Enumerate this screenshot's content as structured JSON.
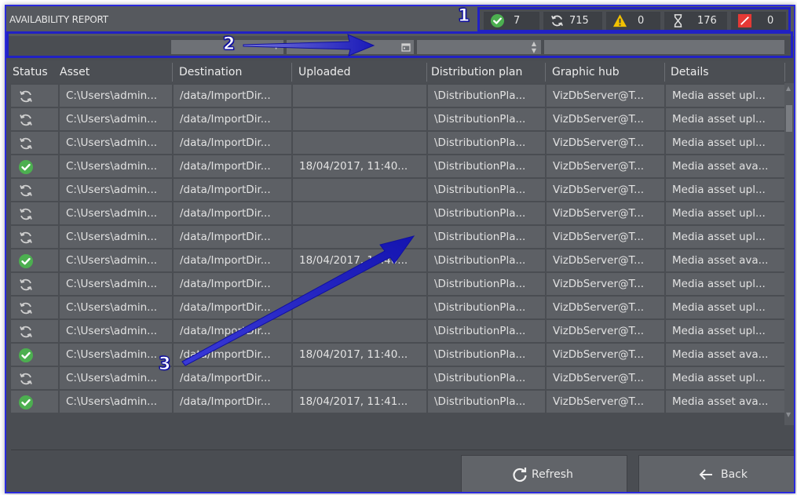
{
  "window": {
    "title": "AVAILABILITY REPORT"
  },
  "summary": {
    "available": {
      "icon": "check-circle-icon",
      "value": "7"
    },
    "in_progress": {
      "icon": "sync-icon",
      "value": "715"
    },
    "warning": {
      "icon": "warning-icon",
      "value": "0"
    },
    "pending": {
      "icon": "hourglass-icon",
      "value": "176"
    },
    "failed": {
      "icon": "error-icon",
      "value": "0"
    }
  },
  "columns": [
    "Status",
    "Asset",
    "Destination",
    "Uploaded",
    "Distribution plan",
    "Graphic hub",
    "Details"
  ],
  "rows": [
    {
      "status": "in_progress",
      "asset": "C:\\Users\\admin...",
      "destination": "/data/ImportDir...",
      "uploaded": "",
      "plan": "\\DistributionPla...",
      "hub": "VizDbServer@T...",
      "details": "Media asset upl..."
    },
    {
      "status": "in_progress",
      "asset": "C:\\Users\\admin...",
      "destination": "/data/ImportDir...",
      "uploaded": "",
      "plan": "\\DistributionPla...",
      "hub": "VizDbServer@T...",
      "details": "Media asset upl..."
    },
    {
      "status": "in_progress",
      "asset": "C:\\Users\\admin...",
      "destination": "/data/ImportDir...",
      "uploaded": "",
      "plan": "\\DistributionPla...",
      "hub": "VizDbServer@T...",
      "details": "Media asset upl..."
    },
    {
      "status": "available",
      "asset": "C:\\Users\\admin...",
      "destination": "/data/ImportDir...",
      "uploaded": "18/04/2017, 11:40...",
      "plan": "\\DistributionPla...",
      "hub": "VizDbServer@T...",
      "details": "Media asset ava..."
    },
    {
      "status": "in_progress",
      "asset": "C:\\Users\\admin...",
      "destination": "/data/ImportDir...",
      "uploaded": "",
      "plan": "\\DistributionPla...",
      "hub": "VizDbServer@T...",
      "details": "Media asset upl..."
    },
    {
      "status": "in_progress",
      "asset": "C:\\Users\\admin...",
      "destination": "/data/ImportDir...",
      "uploaded": "",
      "plan": "\\DistributionPla...",
      "hub": "VizDbServer@T...",
      "details": "Media asset upl..."
    },
    {
      "status": "in_progress",
      "asset": "C:\\Users\\admin...",
      "destination": "/data/ImportDir...",
      "uploaded": "",
      "plan": "\\DistributionPla...",
      "hub": "VizDbServer@T...",
      "details": "Media asset upl..."
    },
    {
      "status": "available",
      "asset": "C:\\Users\\admin...",
      "destination": "/data/ImportDir...",
      "uploaded": "18/04/2017, 11:40...",
      "plan": "\\DistributionPla...",
      "hub": "VizDbServer@T...",
      "details": "Media asset ava..."
    },
    {
      "status": "in_progress",
      "asset": "C:\\Users\\admin...",
      "destination": "/data/ImportDir...",
      "uploaded": "",
      "plan": "\\DistributionPla...",
      "hub": "VizDbServer@T...",
      "details": "Media asset upl..."
    },
    {
      "status": "in_progress",
      "asset": "C:\\Users\\admin...",
      "destination": "/data/ImportDir...",
      "uploaded": "",
      "plan": "\\DistributionPla...",
      "hub": "VizDbServer@T...",
      "details": "Media asset upl..."
    },
    {
      "status": "in_progress",
      "asset": "C:\\Users\\admin...",
      "destination": "/data/ImportDir...",
      "uploaded": "",
      "plan": "\\DistributionPla...",
      "hub": "VizDbServer@T...",
      "details": "Media asset upl..."
    },
    {
      "status": "available",
      "asset": "C:\\Users\\admin...",
      "destination": "/data/ImportDir...",
      "uploaded": "18/04/2017, 11:40...",
      "plan": "\\DistributionPla...",
      "hub": "VizDbServer@T...",
      "details": "Media asset ava..."
    },
    {
      "status": "in_progress",
      "asset": "C:\\Users\\admin...",
      "destination": "/data/ImportDir...",
      "uploaded": "",
      "plan": "\\DistributionPla...",
      "hub": "VizDbServer@T...",
      "details": "Media asset upl..."
    },
    {
      "status": "available",
      "asset": "C:\\Users\\admin...",
      "destination": "/data/ImportDir...",
      "uploaded": "18/04/2017, 11:41...",
      "plan": "\\DistributionPla...",
      "hub": "VizDbServer@T...",
      "details": "Media asset ava..."
    }
  ],
  "buttons": {
    "refresh": "Refresh",
    "back": "Back"
  },
  "annotations": {
    "one": "1",
    "two": "2",
    "three": "3"
  },
  "colors": {
    "accent_green": "#4caf50",
    "warning_yellow": "#f2c200",
    "error_red": "#e53935",
    "annotation_blue": "#2121c4"
  }
}
